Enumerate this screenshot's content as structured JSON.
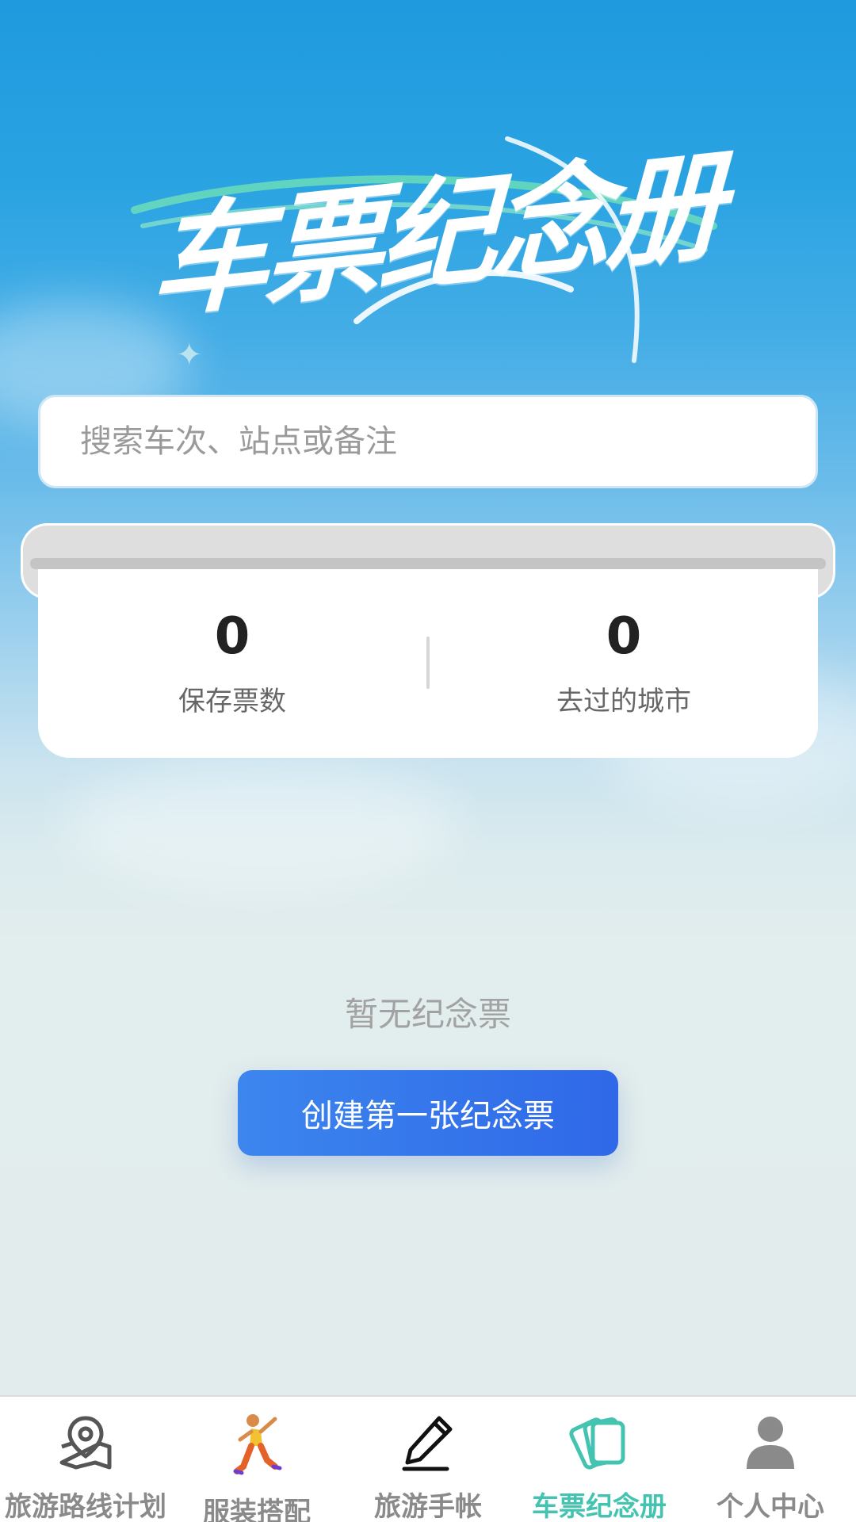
{
  "hero": {
    "title": "车票纪念册"
  },
  "search": {
    "placeholder": "搜索车次、站点或备注",
    "value": ""
  },
  "stats": [
    {
      "value": "0",
      "label": "保存票数"
    },
    {
      "value": "0",
      "label": "去过的城市"
    }
  ],
  "empty": {
    "message": "暂无纪念票",
    "button_label": "创建第一张纪念票"
  },
  "tabbar": {
    "active_color": "#44c4b0",
    "inactive_color": "#8a8a8a",
    "items": [
      {
        "label": "旅游路线计划",
        "icon": "map-pin-icon",
        "active": false
      },
      {
        "label": "服装搭配",
        "icon": "dancing-person-icon",
        "active": false
      },
      {
        "label": "旅游手帐",
        "icon": "pen-icon",
        "active": false
      },
      {
        "label": "车票纪念册",
        "icon": "tickets-icon",
        "active": true
      },
      {
        "label": "个人中心",
        "icon": "user-icon",
        "active": false
      }
    ]
  }
}
